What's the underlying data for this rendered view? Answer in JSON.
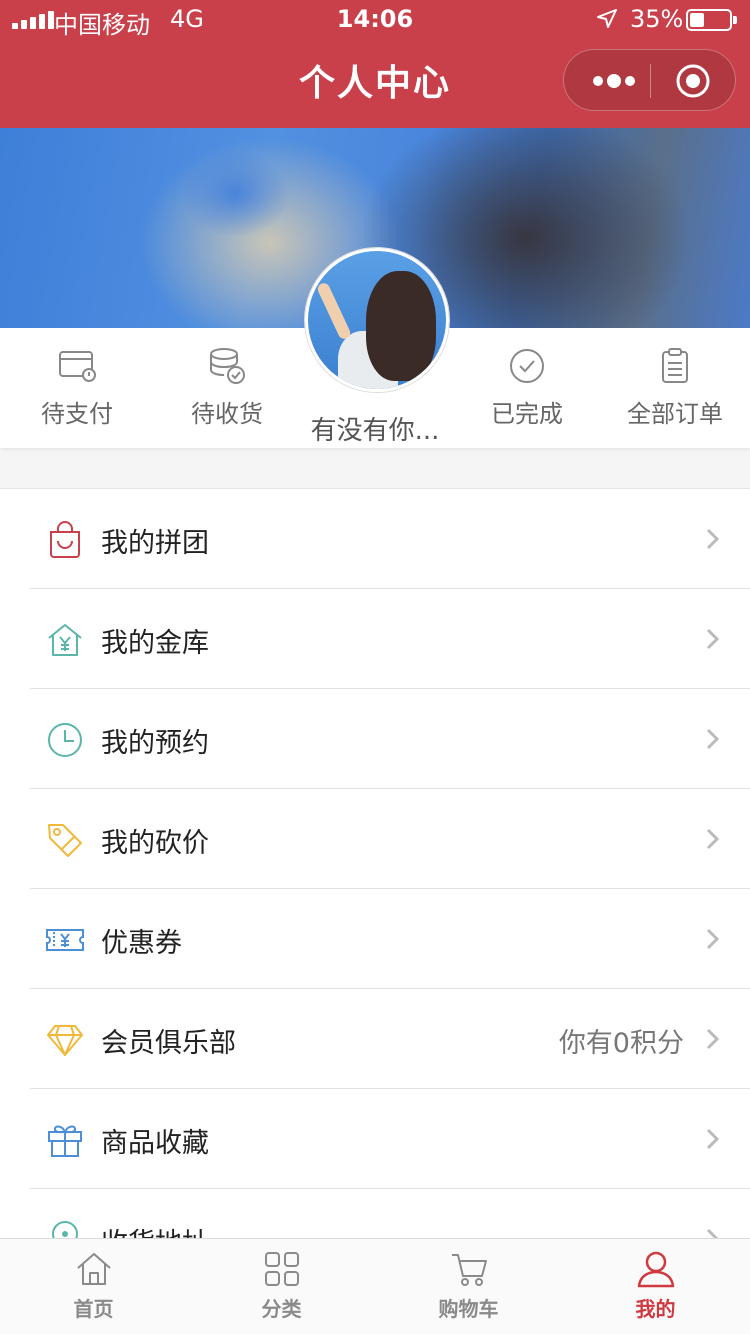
{
  "status_bar": {
    "carrier": "中国移动",
    "network": "4G",
    "time": "14:06",
    "battery": "35%",
    "battery_level": 0.35,
    "location_icon": "location-arrow-icon"
  },
  "nav": {
    "title": "个人中心",
    "more_icon": "more-dots-icon",
    "close_icon": "target-icon"
  },
  "colors": {
    "brand": "#c9404b",
    "tab_active": "#d0393f"
  },
  "profile": {
    "nickname": "有没有你..."
  },
  "orders": [
    {
      "label": "待支付",
      "icon": "wallet-alert-icon"
    },
    {
      "label": "待收货",
      "icon": "coins-check-icon"
    },
    {
      "label": "已完成",
      "icon": "check-circle-icon"
    },
    {
      "label": "全部订单",
      "icon": "clipboard-icon"
    }
  ],
  "menu": [
    {
      "label": "我的拼团",
      "icon": "shopping-bag-icon",
      "color": "#c9404b"
    },
    {
      "label": "我的金库",
      "icon": "vault-house-icon",
      "color": "#5bb6a9"
    },
    {
      "label": "我的预约",
      "icon": "clock-icon",
      "color": "#5bb6a9"
    },
    {
      "label": "我的砍价",
      "icon": "price-tag-icon",
      "color": "#f0b93a"
    },
    {
      "label": "优惠券",
      "icon": "coupon-icon",
      "color": "#4d8fd6"
    },
    {
      "label": "会员俱乐部",
      "icon": "diamond-icon",
      "color": "#f0b93a",
      "extra": "你有0积分"
    },
    {
      "label": "商品收藏",
      "icon": "gift-icon",
      "color": "#4d8fd6"
    },
    {
      "label": "收货地址",
      "icon": "location-pin-icon",
      "color": "#5bb6a9"
    }
  ],
  "tabs": [
    {
      "label": "首页",
      "icon": "home-icon"
    },
    {
      "label": "分类",
      "icon": "grid-icon"
    },
    {
      "label": "购物车",
      "icon": "cart-icon"
    },
    {
      "label": "我的",
      "icon": "user-icon",
      "active": true
    }
  ]
}
